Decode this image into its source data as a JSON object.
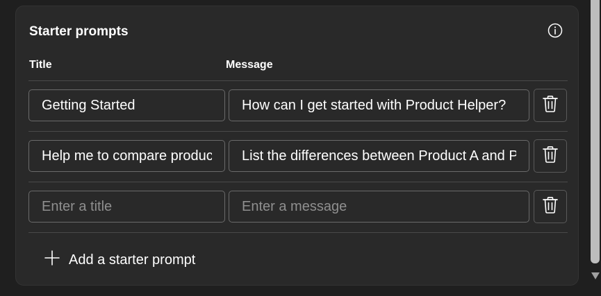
{
  "section": {
    "title": "Starter prompts",
    "info_icon": "info-circle-icon"
  },
  "columns": {
    "title": "Title",
    "message": "Message"
  },
  "prompts": [
    {
      "title": "Getting Started",
      "message": "How can I get started with Product Helper?",
      "title_placeholder": "Enter a title",
      "message_placeholder": "Enter a message",
      "delete_icon": "trash-icon"
    },
    {
      "title": "Help me to compare products",
      "message": "List the differences between Product A and Product B",
      "title_placeholder": "Enter a title",
      "message_placeholder": "Enter a message",
      "delete_icon": "trash-icon"
    },
    {
      "title": "",
      "message": "",
      "title_placeholder": "Enter a title",
      "message_placeholder": "Enter a message",
      "delete_icon": "trash-icon"
    }
  ],
  "add_button": {
    "label": "Add a starter prompt",
    "icon": "plus-icon"
  },
  "colors": {
    "background": "#1f1f1f",
    "card": "#292929",
    "border": "#6b6b6b",
    "text": "#ffffff",
    "placeholder": "#8f8f8f"
  }
}
